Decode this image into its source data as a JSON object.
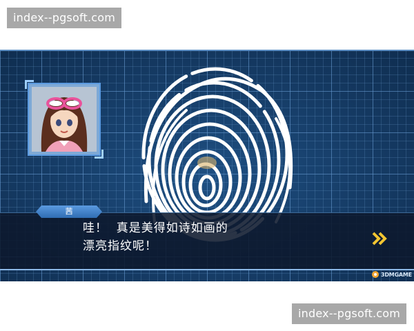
{
  "watermarks": {
    "top": "index--pgsoft.com",
    "bottom": "index--pgsoft.com"
  },
  "dialog": {
    "speaker": "茜",
    "lines": [
      "哇！  真是美得如诗如画的",
      "漂亮指纹呢！"
    ],
    "next_icon": "double-chevron-right-icon"
  },
  "logo": {
    "text": "3DMGAME"
  },
  "colors": {
    "grid_background": "#153a63",
    "dialog_background": "#0c182c",
    "nameplate": "#5b9ae0",
    "arrow": "#f2c531"
  }
}
